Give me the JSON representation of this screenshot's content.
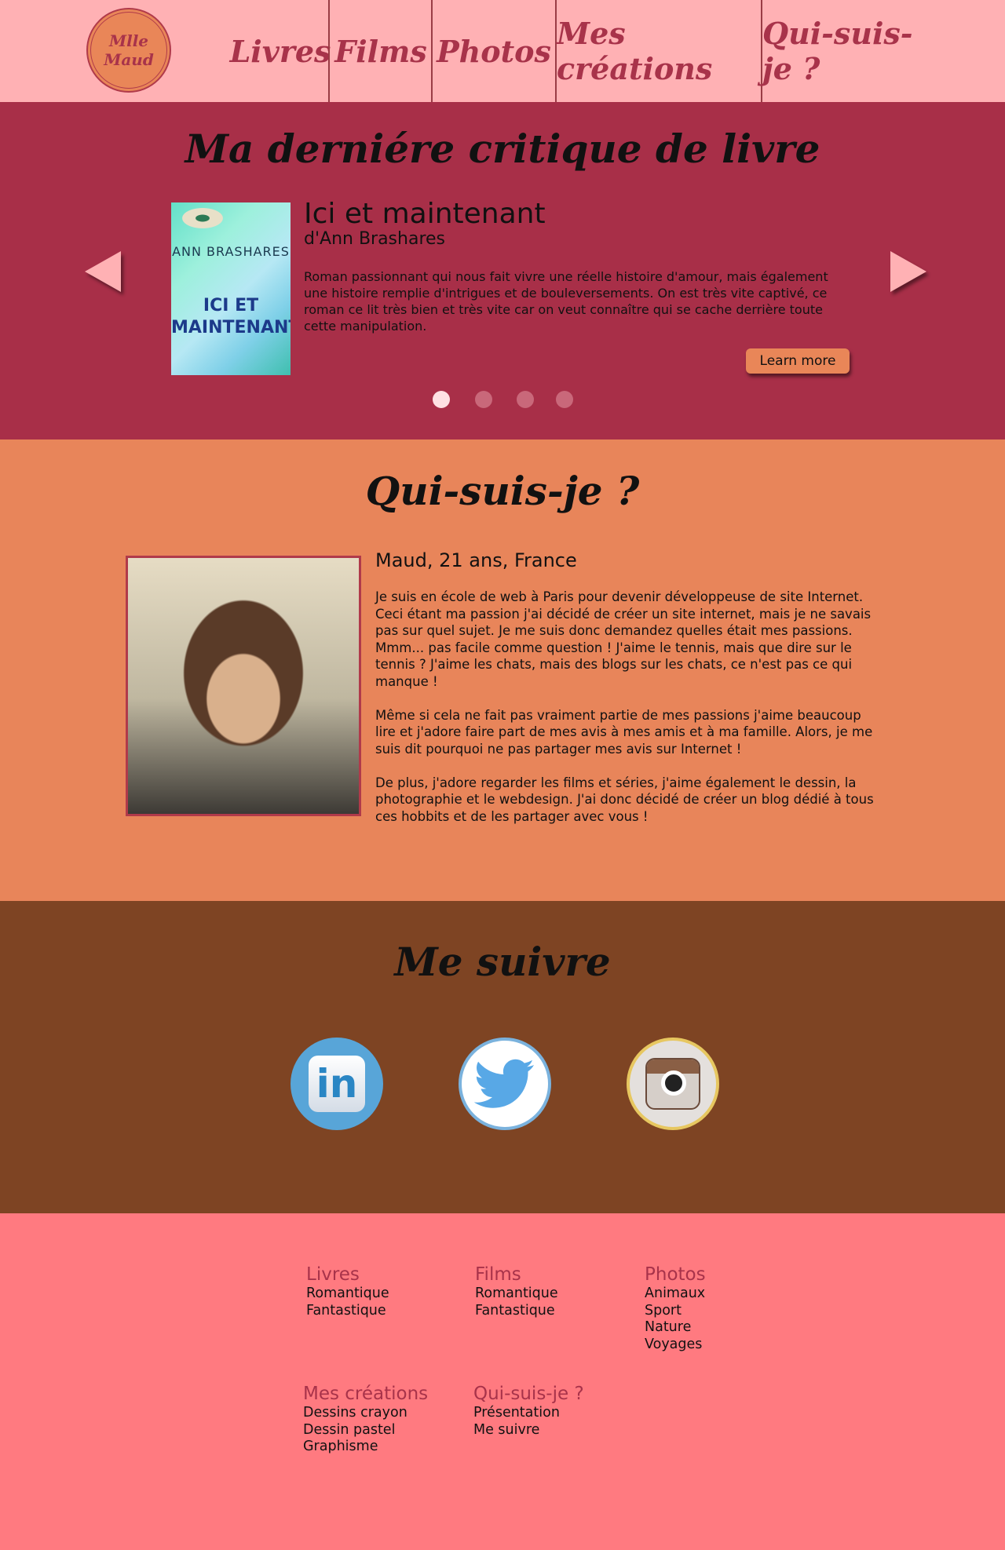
{
  "nav": {
    "logo": "Mlle Maud",
    "items": [
      "Livres",
      "Films",
      "Photos",
      "Mes créations",
      "Qui-suis-je ?"
    ]
  },
  "book_section": {
    "title": "Ma derniére critique de livre",
    "book": {
      "cover_author": "ANN BRASHARES",
      "cover_title": "ICI ET MAINTENANT",
      "title": "Ici et maintenant",
      "author": "d'Ann Brashares",
      "description": "Roman passionnant qui nous fait vivre une réelle histoire d'amour, mais également une histoire remplie d'intrigues et de bouleversements. On est très vite captivé, ce roman ce lit très bien et très vite car on veut connaître qui se cache derrière toute cette manipulation."
    },
    "button": "Learn more",
    "slides": 4,
    "active_slide": 0
  },
  "about": {
    "title": "Qui-suis-je ?",
    "heading": "Maud, 21 ans, France",
    "paragraphs": [
      "Je suis en école de web à Paris pour devenir développeuse de site Internet. Ceci étant ma passion j'ai décidé de créer un site internet, mais je ne savais pas sur quel sujet. Je me suis donc demandez quelles était mes passions. Mmm... pas facile comme question ! J'aime le tennis, mais que dire sur le tennis ? J'aime les chats, mais des blogs sur les chats, ce n'est pas ce qui manque !",
      "Même si cela ne fait pas vraiment partie de mes passions j'aime beaucoup lire et j'adore faire part de mes avis à mes amis et à ma famille. Alors, je me suis dit pourquoi ne pas partager mes avis sur Internet !",
      "De plus, j'adore regarder les films et séries, j'aime également le dessin, la photographie et le webdesign. J'ai donc décidé de créer un blog dédié à tous ces hobbits et de les partager avec vous !"
    ]
  },
  "follow": {
    "title": "Me suivre",
    "linkedin_text": "in",
    "icons": [
      "linkedin-icon",
      "twitter-icon",
      "instagram-icon"
    ]
  },
  "footer": {
    "columns": [
      {
        "title": "Livres",
        "links": [
          "Romantique",
          "Fantastique"
        ]
      },
      {
        "title": "Films",
        "links": [
          "Romantique",
          "Fantastique"
        ]
      },
      {
        "title": "Photos",
        "links": [
          "Animaux",
          "Sport",
          "Nature",
          "Voyages"
        ]
      },
      {
        "title": "Mes créations",
        "links": [
          "Dessins crayon",
          "Dessin pastel",
          "Graphisme"
        ]
      },
      {
        "title": "Qui-suis-je ?",
        "links": [
          "Présentation",
          "Me suivre"
        ]
      }
    ]
  },
  "colors": {
    "nav_bg": "#ffb1b4",
    "book_bg": "#a82f48",
    "about_bg": "#e8855a",
    "follow_bg": "#7e4423",
    "footer_bg": "#ff7a80",
    "accent": "#a8334a"
  }
}
